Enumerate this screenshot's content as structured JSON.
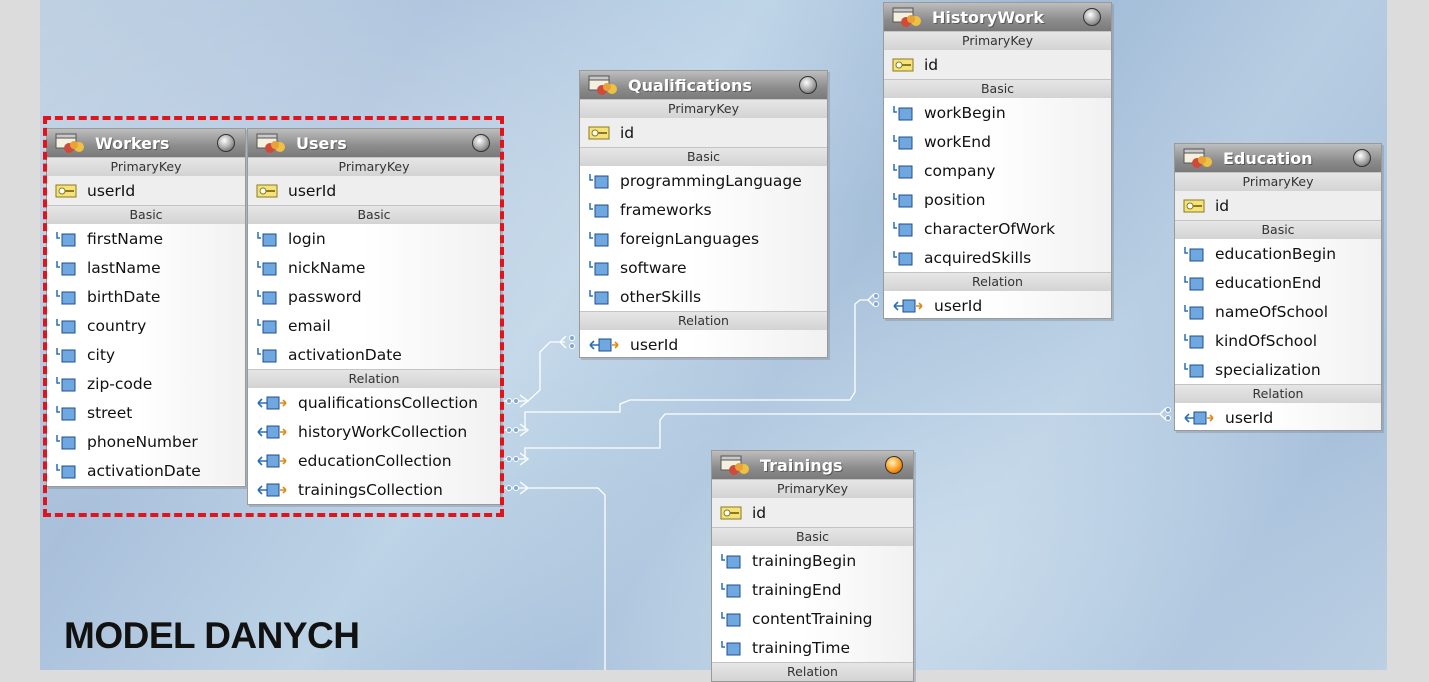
{
  "diagram_title": "MODEL DANYCH",
  "colors": {
    "selection_border": "#e0141c",
    "header": "#8c8c8c",
    "connector": "#ffffff"
  },
  "entities": {
    "workers": {
      "title": "Workers",
      "primary_label": "PrimaryKey",
      "basic_label": "Basic",
      "primary": [
        "userId"
      ],
      "basic": [
        "firstName",
        "lastName",
        "birthDate",
        "country",
        "city",
        "zip-code",
        "street",
        "phoneNumber",
        "activationDate"
      ]
    },
    "users": {
      "title": "Users",
      "primary_label": "PrimaryKey",
      "basic_label": "Basic",
      "relation_label": "Relation",
      "primary": [
        "userId"
      ],
      "basic": [
        "login",
        "nickName",
        "password",
        "email",
        "activationDate"
      ],
      "relation": [
        "qualificationsCollection",
        "historyWorkCollection",
        "educationCollection",
        "trainingsCollection"
      ]
    },
    "qualifications": {
      "title": "Qualifications",
      "primary_label": "PrimaryKey",
      "basic_label": "Basic",
      "relation_label": "Relation",
      "primary": [
        "id"
      ],
      "basic": [
        "programmingLanguage",
        "frameworks",
        "foreignLanguages",
        "software",
        "otherSkills"
      ],
      "relation": [
        "userId"
      ]
    },
    "historywork": {
      "title": "HistoryWork",
      "primary_label": "PrimaryKey",
      "basic_label": "Basic",
      "relation_label": "Relation",
      "primary": [
        "id"
      ],
      "basic": [
        "workBegin",
        "workEnd",
        "company",
        "position",
        "characterOfWork",
        "acquiredSkills"
      ],
      "relation": [
        "userId"
      ]
    },
    "education": {
      "title": "Education",
      "primary_label": "PrimaryKey",
      "basic_label": "Basic",
      "relation_label": "Relation",
      "primary": [
        "id"
      ],
      "basic": [
        "educationBegin",
        "educationEnd",
        "nameOfSchool",
        "kindOfSchool",
        "specialization"
      ],
      "relation": [
        "userId"
      ]
    },
    "trainings": {
      "title": "Trainings",
      "primary_label": "PrimaryKey",
      "basic_label": "Basic",
      "relation_label": "Relation",
      "primary": [
        "id"
      ],
      "basic": [
        "trainingBegin",
        "trainingEnd",
        "contentTraining",
        "trainingTime"
      ],
      "relation": []
    }
  }
}
